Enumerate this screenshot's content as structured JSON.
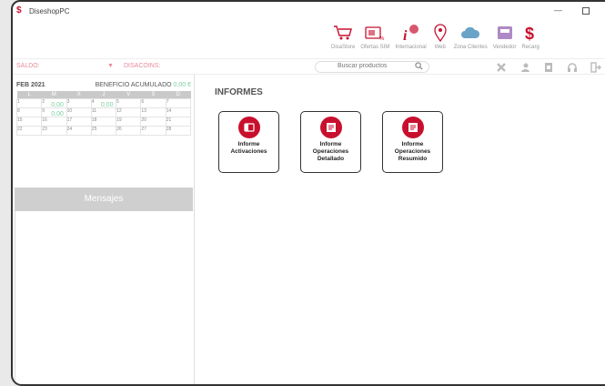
{
  "window": {
    "title": "DiseshopPC",
    "minimize_glyph": "—"
  },
  "nav": [
    {
      "label": "DisaStore",
      "icon": "cart-icon"
    },
    {
      "label": "Ofertas SIM",
      "icon": "sim-offers-icon"
    },
    {
      "label": "Internacional",
      "icon": "international-icon"
    },
    {
      "label": "Web",
      "icon": "location-pin-icon"
    },
    {
      "label": "Zona Clientes",
      "icon": "cloud-icon"
    },
    {
      "label": "Vendedor",
      "icon": "vendor-icon"
    },
    {
      "label": "Recarg",
      "icon": "dollar-icon"
    }
  ],
  "toolbar": {
    "saldo_label": "SALDO:",
    "saldo_arrow": "▼",
    "disacoins_label": "DISACOINS:",
    "search_placeholder": "Buscar productos",
    "search_glyph": "🔍"
  },
  "calendar": {
    "month": "FEB 2021",
    "benefit_label": "BENEFICIO ACUMULADO",
    "benefit_value": "0,00 €",
    "weekdays": [
      "L",
      "M",
      "X",
      "J",
      "V",
      "S",
      "D"
    ],
    "weeks": [
      [
        {
          "d": "1"
        },
        {
          "d": "2",
          "v": "0,00"
        },
        {
          "d": "3"
        },
        {
          "d": "4",
          "v": "0,00"
        },
        {
          "d": "5"
        },
        {
          "d": "6"
        },
        {
          "d": "7"
        }
      ],
      [
        {
          "d": "8"
        },
        {
          "d": "9",
          "v": "0,00"
        },
        {
          "d": "10"
        },
        {
          "d": "11"
        },
        {
          "d": "12"
        },
        {
          "d": "13"
        },
        {
          "d": "14"
        }
      ],
      [
        {
          "d": "15"
        },
        {
          "d": "16"
        },
        {
          "d": "17"
        },
        {
          "d": "18"
        },
        {
          "d": "19"
        },
        {
          "d": "20"
        },
        {
          "d": "21"
        }
      ],
      [
        {
          "d": "22"
        },
        {
          "d": "23"
        },
        {
          "d": "24"
        },
        {
          "d": "25"
        },
        {
          "d": "26"
        },
        {
          "d": "27"
        },
        {
          "d": "28"
        }
      ]
    ]
  },
  "messages": {
    "title": "Mensajes"
  },
  "main": {
    "title": "INFORMES",
    "cards": [
      {
        "label_lines": [
          "Informe",
          "Activaciones"
        ],
        "icon": "activation-report-icon"
      },
      {
        "label_lines": [
          "Informe",
          "Operaciones",
          "Detallado"
        ],
        "icon": "detailed-report-icon"
      },
      {
        "label_lines": [
          "Informe",
          "Operaciones",
          "Resumido"
        ],
        "icon": "summary-report-icon"
      }
    ]
  },
  "colors": {
    "brand": "#c8102e",
    "accent_green": "#7dcfa0",
    "saldo_pink": "#e88a9a"
  }
}
